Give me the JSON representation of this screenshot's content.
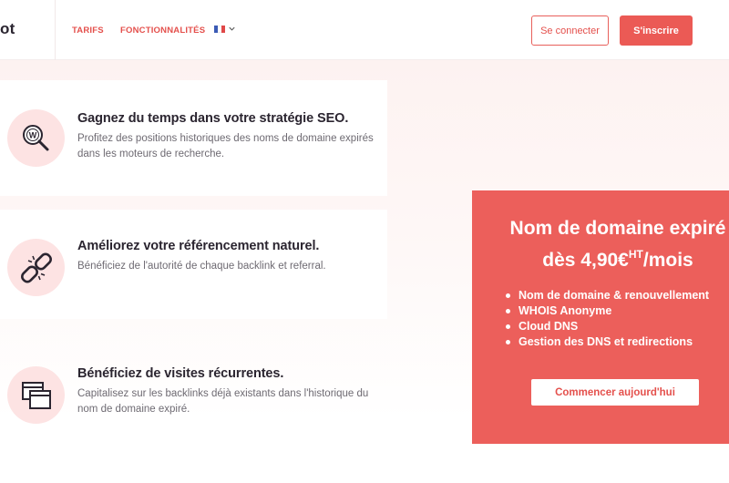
{
  "header": {
    "logo": "ot",
    "nav": {
      "tarifs": "TARIFS",
      "features": "FONCTIONNALITÉS"
    },
    "language_flag": "french-flag-icon",
    "login_label": "Se connecter",
    "signup_label": "S'inscrire"
  },
  "features": [
    {
      "icon": "seo-search-icon",
      "icon_letter": "W",
      "title": "Gagnez du temps dans votre stratégie SEO.",
      "text": "Profitez des positions historiques des noms de domaine expirés dans les moteurs de recherche."
    },
    {
      "icon": "broken-link-icon",
      "title": "Améliorez votre référencement naturel.",
      "text": "Bénéficiez de l'autorité de chaque backlink et referral."
    },
    {
      "icon": "browser-windows-icon",
      "title": "Bénéficiez de visites récurrentes.",
      "text": "Capitalisez sur les backlinks déjà existants dans l'historique du nom de domaine expiré."
    }
  ],
  "promo": {
    "title_line1": "Nom de domaine expiré",
    "price_prefix": "dès 4,90€",
    "price_sup": "HT",
    "price_suffix": "/mois",
    "items": [
      "Nom de domaine & renouvellement",
      "WHOIS Anonyme",
      "Cloud DNS",
      "Gestion des DNS et redirections"
    ],
    "cta_label": "Commencer aujourd'hui"
  },
  "colors": {
    "accent": "#eb5a55",
    "promo_bg": "#ec5f5b",
    "icon_circle": "#fde3e3",
    "text_dark": "#2b2530",
    "text_muted": "#6e6a72"
  }
}
